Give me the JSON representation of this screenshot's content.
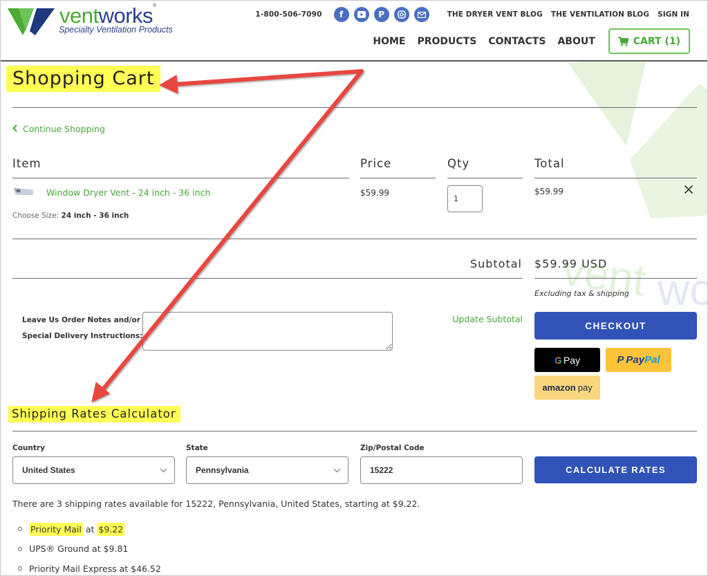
{
  "header": {
    "logo": {
      "word_part1": "vent",
      "word_part2": "works",
      "registered": "®",
      "tagline": "Specialty Ventilation Products",
      "colors": {
        "green": "#4bab34",
        "navy": "#2a3f8f"
      }
    },
    "phone": "1-800-506-7090",
    "social": [
      {
        "name": "facebook-icon",
        "glyph": "f"
      },
      {
        "name": "youtube-icon",
        "glyph": "▶"
      },
      {
        "name": "pinterest-icon",
        "glyph": "P"
      },
      {
        "name": "instagram-icon",
        "glyph": "◎"
      },
      {
        "name": "email-icon",
        "glyph": "✉"
      }
    ],
    "top_links": [
      "THE DRYER VENT BLOG",
      "THE VENTILATION BLOG",
      "SIGN IN"
    ],
    "nav": [
      "HOME",
      "PRODUCTS",
      "CONTACTS",
      "ABOUT"
    ],
    "cart_label": "CART (1)"
  },
  "cart": {
    "title": "Shopping Cart",
    "continue_shopping": "Continue Shopping",
    "columns": [
      "Item",
      "Price",
      "Qty",
      "Total"
    ],
    "items": [
      {
        "name": "Window Dryer Vent - 24 inch - 36 inch",
        "option_label": "Choose Size:",
        "option_value": "24 inch - 36 inch",
        "price": "$59.99",
        "qty": "1",
        "total": "$59.99",
        "remove_glyph": "✕"
      }
    ],
    "subtotal_label": "Subtotal",
    "subtotal_value": "$59.99 USD",
    "excluding_note": "Excluding tax & shipping",
    "notes_label_line1": "Leave Us Order Notes and/or",
    "notes_label_line2": "Special Delivery Instructions:",
    "notes_value": "",
    "update_subtotal": "Update Subtotal",
    "checkout": "CHECKOUT",
    "express_pay": {
      "gpay_g": "G",
      "gpay_label": "Pay",
      "paypal_part1": "Pay",
      "paypal_part2": "Pal",
      "paypal_mark": "P",
      "amazon_part1": "amazon",
      "amazon_part2": "pay"
    }
  },
  "shipping": {
    "title": "Shipping Rates Calculator",
    "country_label": "Country",
    "country_value": "United States",
    "state_label": "State",
    "state_value": "Pennsylvania",
    "zip_label": "Zip/Postal Code",
    "zip_value": "15222",
    "calculate": "CALCULATE RATES",
    "summary": "There are 3 shipping rates available for 15222, Pennsylvania, United States, starting at $9.22.",
    "rates": [
      {
        "service": "Priority Mail",
        "joiner": " at ",
        "price": "$9.22",
        "highlighted": true
      },
      {
        "service": "UPS® Ground",
        "joiner": " at ",
        "price": "$9.81",
        "highlighted": false
      },
      {
        "service": "Priority Mail Express",
        "joiner": " at ",
        "price": "$46.52",
        "highlighted": false
      }
    ]
  },
  "annotations": {
    "highlight_color": "#ffff55",
    "arrow_color": "#e8463f"
  },
  "theme": {
    "accent_green": "#44a833",
    "button_blue": "#3153b8",
    "social_blue": "#4a6ec2"
  }
}
